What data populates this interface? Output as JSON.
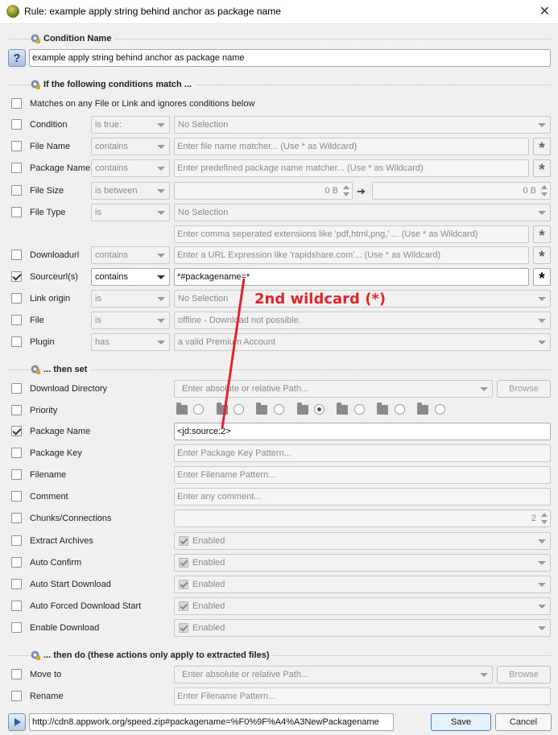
{
  "window": {
    "title": "Rule: example apply string behind anchor as package name",
    "close_icon": "close-icon"
  },
  "sections": {
    "condition_name": "Condition Name",
    "conditions": "If the following conditions match ...",
    "then_set": "... then set",
    "then_do": "... then do (these actions only apply to extracted files)"
  },
  "condition_name": {
    "value": "example apply string behind anchor as package name",
    "help": "?"
  },
  "match_any": {
    "label": "Matches on any File or Link and ignores conditions below",
    "checked": false
  },
  "conditions": {
    "condition": {
      "label": "Condition",
      "op": "is true:",
      "value": "No Selection"
    },
    "file_name": {
      "label": "File Name",
      "op": "contains",
      "placeholder": "Enter file name matcher... (Use * as Wildcard)"
    },
    "package_name": {
      "label": "Package Name",
      "op": "contains",
      "placeholder": "Enter predefined package name matcher... (Use * as Wildcard)"
    },
    "file_size": {
      "label": "File Size",
      "op": "is between",
      "from": "0 B",
      "to": "0 B"
    },
    "file_type": {
      "label": "File Type",
      "op": "is",
      "value": "No Selection",
      "ext_placeholder": "Enter comma seperated extensions like 'pdf,html,png,' ... (Use * as Wildcard)"
    },
    "downloadurl": {
      "label": "Downloadurl",
      "op": "contains",
      "placeholder": "Enter a URL Expression like 'rapidshare.com'... (Use * as Wildcard)"
    },
    "sourceurl": {
      "label": "Sourceurl(s)",
      "op": "contains",
      "value": "*#packagename=*",
      "checked": true
    },
    "link_origin": {
      "label": "Link origin",
      "op": "is",
      "value": "No Selection"
    },
    "file": {
      "label": "File",
      "op": "is",
      "value": "offline - Download not possible."
    },
    "plugin": {
      "label": "Plugin",
      "op": "has",
      "value": "a valid Premium Account"
    }
  },
  "then_set": {
    "download_directory": {
      "label": "Download Directory",
      "placeholder": "Enter absolute or relative Path...",
      "browse": "Browse"
    },
    "priority": {
      "label": "Priority"
    },
    "package_name": {
      "label": "Package Name",
      "value": "<jd:source:2>",
      "checked": true
    },
    "package_key": {
      "label": "Package Key",
      "placeholder": "Enter Package Key Pattern..."
    },
    "filename": {
      "label": "Filename",
      "placeholder": "Enter Filename Pattern..."
    },
    "comment": {
      "label": "Comment",
      "placeholder": "Enter any comment..."
    },
    "chunks": {
      "label": "Chunks/Connections",
      "value": "2"
    },
    "extract_archives": {
      "label": "Extract Archives",
      "value": "Enabled"
    },
    "auto_confirm": {
      "label": "Auto Confirm",
      "value": "Enabled"
    },
    "auto_start": {
      "label": "Auto Start Download",
      "value": "Enabled"
    },
    "auto_forced": {
      "label": "Auto Forced Download Start",
      "value": "Enabled"
    },
    "enable_download": {
      "label": "Enable Download",
      "value": "Enabled"
    }
  },
  "then_do": {
    "move_to": {
      "label": "Move to",
      "placeholder": "Enter absolute or relative Path...",
      "browse": "Browse"
    },
    "rename": {
      "label": "Rename",
      "placeholder": "Enter Filename Pattern..."
    }
  },
  "footer": {
    "test_url": "http://cdn8.appwork.org/speed.zip#packagename=%F0%9F%A4%A3NewPackagename",
    "save": "Save",
    "cancel": "Cancel"
  },
  "annotation": {
    "text": "2nd wildcard (*)",
    "color": "#e4232a"
  }
}
